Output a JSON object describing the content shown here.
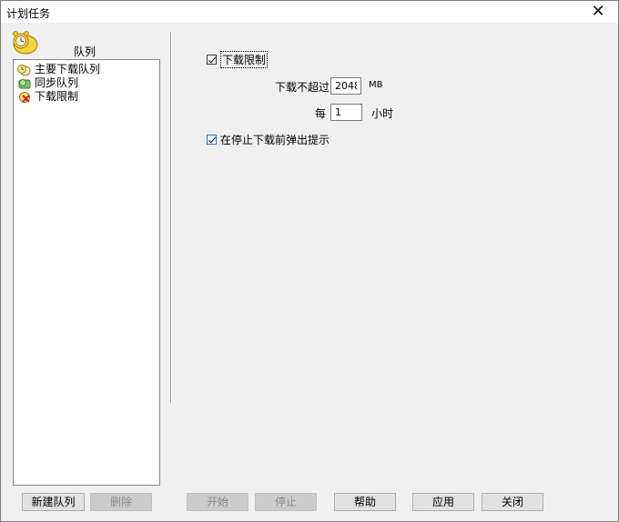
{
  "window": {
    "title": "计划任务",
    "close_glyph": "✕"
  },
  "queue_panel": {
    "header_label": "队列",
    "header_icon": "alarm-clock-icon",
    "items": [
      {
        "label": "主要下载队列",
        "icon": "clock-queue-icon"
      },
      {
        "label": "同步队列",
        "icon": "sync-queue-icon"
      },
      {
        "label": "下载限制",
        "icon": "limit-queue-icon"
      }
    ]
  },
  "limit_settings": {
    "enable_label": "下载限制",
    "enable_checked": true,
    "max_label": "下载不超过",
    "max_value": "2048",
    "max_unit": "MB",
    "every_label": "每",
    "every_value": "1",
    "every_unit": "小时",
    "prompt_label": "在停止下载前弹出提示",
    "prompt_checked": true
  },
  "buttons": {
    "new_queue": "新建队列",
    "delete": "删除",
    "start": "开始",
    "stop": "停止",
    "help": "帮助",
    "apply": "应用",
    "close": "关闭"
  }
}
